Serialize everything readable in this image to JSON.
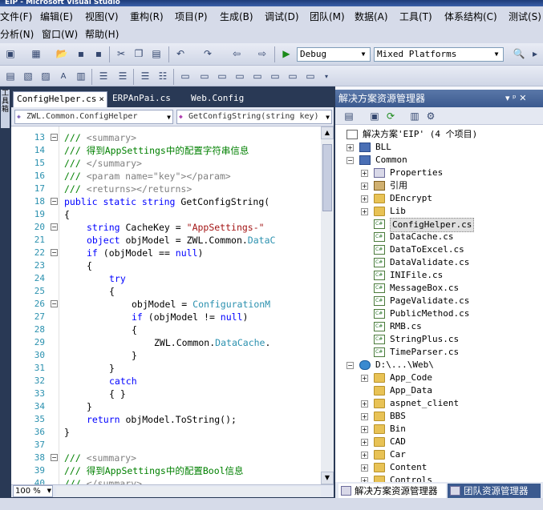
{
  "window": {
    "title": "EIP - Microsoft Visual Studio"
  },
  "menu": {
    "row1": [
      "文件(F)",
      "编辑(E)",
      "视图(V)",
      "重构(R)",
      "项目(P)",
      "生成(B)",
      "调试(D)",
      "团队(M)",
      "数据(A)",
      "工具(T)",
      "体系结构(C)",
      "测试(S)"
    ],
    "row2": [
      "分析(N)",
      "窗口(W)",
      "帮助(H)"
    ]
  },
  "toolbar": {
    "config": "Debug",
    "platform": "Mixed Platforms"
  },
  "left_strip": {
    "label": "工具箱"
  },
  "tabs": [
    {
      "label": "ConfigHelper.cs",
      "active": true,
      "close": "×"
    },
    {
      "label": "ERPAnPai.cs",
      "active": false
    },
    {
      "label": "Web.Config",
      "active": false
    }
  ],
  "nav": {
    "class": "ZWL.Common.ConfigHelper",
    "member": "GetConfigString(string key)"
  },
  "code": {
    "lines": [
      {
        "n": "13",
        "indent": 2,
        "parts": [
          [
            "cm",
            "/// "
          ],
          [
            "xd",
            "<summary>"
          ]
        ]
      },
      {
        "n": "14",
        "indent": 2,
        "parts": [
          [
            "cm",
            "/// 得到AppSettings中的配置字符串信息"
          ]
        ]
      },
      {
        "n": "15",
        "indent": 2,
        "parts": [
          [
            "cm",
            "/// "
          ],
          [
            "xd",
            "</summary>"
          ]
        ]
      },
      {
        "n": "16",
        "indent": 2,
        "parts": [
          [
            "cm",
            "/// "
          ],
          [
            "xd",
            "<param name=\"key\"></param>"
          ]
        ]
      },
      {
        "n": "17",
        "indent": 2,
        "parts": [
          [
            "cm",
            "/// "
          ],
          [
            "xd",
            "<returns></returns>"
          ]
        ]
      },
      {
        "n": "18",
        "indent": 2,
        "parts": [
          [
            "kw",
            "public static string "
          ],
          [
            "tx",
            "GetConfigString("
          ]
        ]
      },
      {
        "n": "19",
        "indent": 2,
        "parts": [
          [
            "tx",
            "{"
          ]
        ]
      },
      {
        "n": "20",
        "indent": 3,
        "parts": [
          [
            "kw",
            "string "
          ],
          [
            "tx",
            "CacheKey = "
          ],
          [
            "st",
            "\"AppSettings-\""
          ]
        ]
      },
      {
        "n": "21",
        "indent": 3,
        "parts": [
          [
            "kw",
            "object "
          ],
          [
            "tx",
            "objModel = ZWL.Common."
          ],
          [
            "ty",
            "DataC"
          ]
        ]
      },
      {
        "n": "22",
        "indent": 3,
        "parts": [
          [
            "kw",
            "if "
          ],
          [
            "tx",
            "(objModel == "
          ],
          [
            "kw",
            "null"
          ],
          [
            "tx",
            ")"
          ]
        ]
      },
      {
        "n": "23",
        "indent": 3,
        "parts": [
          [
            "tx",
            "{"
          ]
        ]
      },
      {
        "n": "24",
        "indent": 4,
        "parts": [
          [
            "kw",
            "try"
          ]
        ]
      },
      {
        "n": "25",
        "indent": 4,
        "parts": [
          [
            "tx",
            "{"
          ]
        ]
      },
      {
        "n": "26",
        "indent": 5,
        "parts": [
          [
            "tx",
            "objModel = "
          ],
          [
            "ty",
            "ConfigurationM"
          ]
        ]
      },
      {
        "n": "27",
        "indent": 5,
        "parts": [
          [
            "kw",
            "if "
          ],
          [
            "tx",
            "(objModel != "
          ],
          [
            "kw",
            "null"
          ],
          [
            "tx",
            ")"
          ]
        ]
      },
      {
        "n": "28",
        "indent": 5,
        "parts": [
          [
            "tx",
            "{"
          ]
        ]
      },
      {
        "n": "29",
        "indent": 6,
        "parts": [
          [
            "tx",
            "ZWL.Common."
          ],
          [
            "ty",
            "DataCache"
          ],
          [
            "tx",
            "."
          ]
        ]
      },
      {
        "n": "30",
        "indent": 5,
        "parts": [
          [
            "tx",
            "}"
          ]
        ]
      },
      {
        "n": "31",
        "indent": 4,
        "parts": [
          [
            "tx",
            "}"
          ]
        ]
      },
      {
        "n": "32",
        "indent": 4,
        "parts": [
          [
            "kw",
            "catch"
          ]
        ]
      },
      {
        "n": "33",
        "indent": 4,
        "parts": [
          [
            "tx",
            "{ }"
          ]
        ]
      },
      {
        "n": "34",
        "indent": 3,
        "parts": [
          [
            "tx",
            "}"
          ]
        ]
      },
      {
        "n": "35",
        "indent": 3,
        "parts": [
          [
            "kw",
            "return "
          ],
          [
            "tx",
            "objModel.ToString();"
          ]
        ]
      },
      {
        "n": "36",
        "indent": 2,
        "parts": [
          [
            "tx",
            "}"
          ]
        ]
      },
      {
        "n": "37",
        "indent": 2,
        "parts": []
      },
      {
        "n": "38",
        "indent": 2,
        "parts": [
          [
            "cm",
            "/// "
          ],
          [
            "xd",
            "<summary>"
          ]
        ]
      },
      {
        "n": "39",
        "indent": 2,
        "parts": [
          [
            "cm",
            "/// 得到AppSettings中的配置Bool信息"
          ]
        ]
      },
      {
        "n": "40",
        "indent": 2,
        "parts": [
          [
            "cm",
            "/// "
          ],
          [
            "xd",
            "</summary>"
          ]
        ]
      }
    ],
    "collapse": [
      "13",
      "18",
      "20",
      "22",
      "26",
      "38"
    ]
  },
  "status": {
    "zoom": "100 %"
  },
  "solution_explorer": {
    "title": "解决方案资源管理器",
    "pin": "▾ ᵖ ✕",
    "items": [
      {
        "label": "解决方案'EIP' (4 个项目)",
        "level": 0,
        "icon": "solico",
        "exp": ""
      },
      {
        "label": "BLL",
        "level": 1,
        "icon": "projico",
        "exp": "+"
      },
      {
        "label": "Common",
        "level": 1,
        "icon": "projico",
        "exp": "-"
      },
      {
        "label": "Properties",
        "level": 2,
        "icon": "propico",
        "exp": "+"
      },
      {
        "label": "引用",
        "level": 2,
        "icon": "refico",
        "exp": "+"
      },
      {
        "label": "DEncrypt",
        "level": 2,
        "icon": "folder",
        "exp": "+"
      },
      {
        "label": "Lib",
        "level": 2,
        "icon": "folder",
        "exp": "+"
      },
      {
        "label": "ConfigHelper.cs",
        "level": 2,
        "icon": "csfile",
        "exp": "",
        "selected": true
      },
      {
        "label": "DataCache.cs",
        "level": 2,
        "icon": "csfile",
        "exp": ""
      },
      {
        "label": "DataToExcel.cs",
        "level": 2,
        "icon": "csfile",
        "exp": ""
      },
      {
        "label": "DataValidate.cs",
        "level": 2,
        "icon": "csfile",
        "exp": ""
      },
      {
        "label": "INIFile.cs",
        "level": 2,
        "icon": "csfile",
        "exp": ""
      },
      {
        "label": "MessageBox.cs",
        "level": 2,
        "icon": "csfile",
        "exp": ""
      },
      {
        "label": "PageValidate.cs",
        "level": 2,
        "icon": "csfile",
        "exp": ""
      },
      {
        "label": "PublicMethod.cs",
        "level": 2,
        "icon": "csfile",
        "exp": ""
      },
      {
        "label": "RMB.cs",
        "level": 2,
        "icon": "csfile",
        "exp": ""
      },
      {
        "label": "StringPlus.cs",
        "level": 2,
        "icon": "csfile",
        "exp": ""
      },
      {
        "label": "TimeParser.cs",
        "level": 2,
        "icon": "csfile",
        "exp": ""
      },
      {
        "label": "D:\\...\\Web\\",
        "level": 1,
        "icon": "webico",
        "exp": "-"
      },
      {
        "label": "App_Code",
        "level": 2,
        "icon": "folder",
        "exp": "+"
      },
      {
        "label": "App_Data",
        "level": 2,
        "icon": "folder",
        "exp": ""
      },
      {
        "label": "aspnet_client",
        "level": 2,
        "icon": "folder",
        "exp": "+"
      },
      {
        "label": "BBS",
        "level": 2,
        "icon": "folder",
        "exp": "+"
      },
      {
        "label": "Bin",
        "level": 2,
        "icon": "folder",
        "exp": "+"
      },
      {
        "label": "CAD",
        "level": 2,
        "icon": "folder",
        "exp": "+"
      },
      {
        "label": "Car",
        "level": 2,
        "icon": "folder",
        "exp": "+"
      },
      {
        "label": "Content",
        "level": 2,
        "icon": "folder",
        "exp": "+"
      },
      {
        "label": "Controls",
        "level": 2,
        "icon": "folder",
        "exp": "+"
      }
    ],
    "bottom_tabs": [
      {
        "label": "解决方案资源管理器",
        "active": true
      },
      {
        "label": "团队资源管理器",
        "active": false
      }
    ]
  }
}
